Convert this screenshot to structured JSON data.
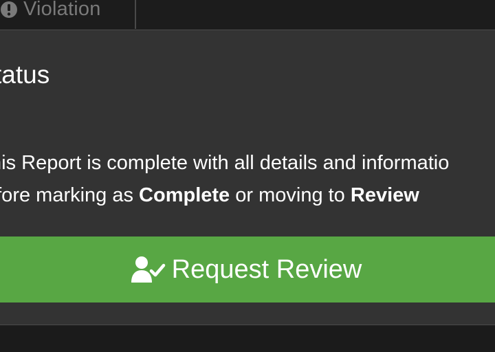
{
  "tabs": {
    "violation": {
      "label": "Violation",
      "icon": "exclamation-circle-icon"
    }
  },
  "panel": {
    "title": "tatus",
    "message": {
      "line1": "this Report is complete with all details and informatio",
      "line2_prefix": "efore marking as ",
      "line2_complete": "Complete",
      "line2_middle": " or moving to ",
      "line2_review": "Review"
    },
    "request_button": {
      "label": "Request Review",
      "icon": "user-check-icon"
    }
  },
  "colors": {
    "panel_bg": "#333333",
    "page_bg": "#1e1e1e",
    "button_green": "#58a744",
    "muted_text": "#7a7a7a"
  }
}
